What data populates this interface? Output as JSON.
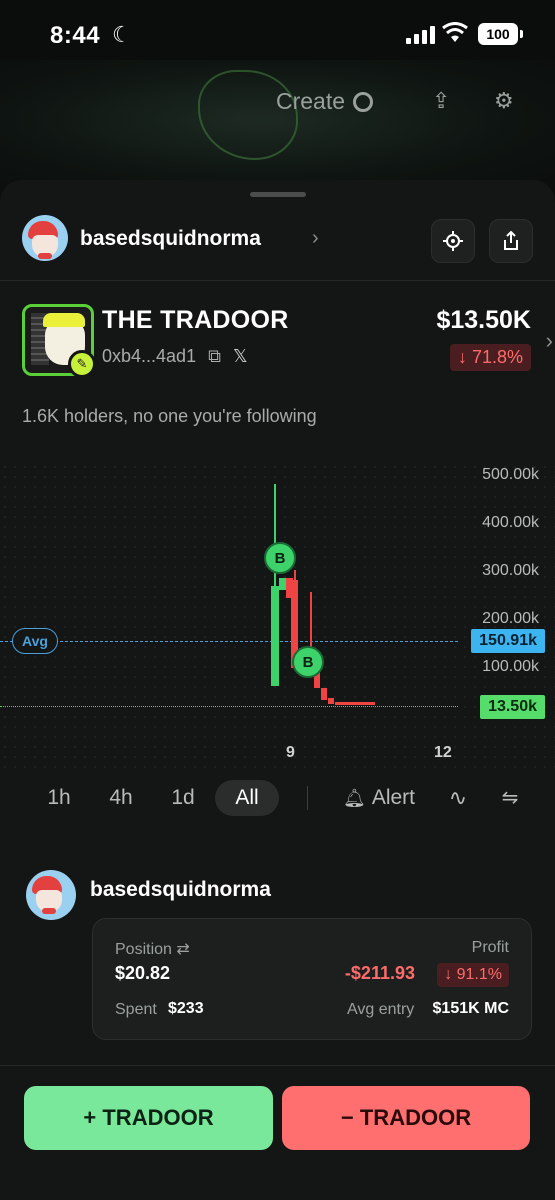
{
  "status_bar": {
    "time": "8:44",
    "battery": "100"
  },
  "background": {
    "create_label": "Create"
  },
  "header": {
    "username": "basedsquidnorma"
  },
  "token": {
    "name": "THE TRADOOR",
    "address": "0xb4...4ad1",
    "price": "$13.50K",
    "change": "↓ 71.8%"
  },
  "holders_text": "1.6K holders, no one you're following",
  "chart_data": {
    "type": "candlestick",
    "yticks": [
      "500.00k",
      "400.00k",
      "300.00k",
      "200.00k",
      "100.00k"
    ],
    "xticks": [
      "9",
      "12"
    ],
    "avg_label": "Avg",
    "avg_value": "150.91k",
    "current_value": "13.50k",
    "markers": [
      "B",
      "B"
    ]
  },
  "timeframes": {
    "items": [
      "1h",
      "4h",
      "1d",
      "All"
    ],
    "active": "All",
    "alert_label": "Alert"
  },
  "position": {
    "username": "basedsquidnorma",
    "position_label": "Position",
    "position_value": "$20.82",
    "profit_label": "Profit",
    "profit_value": "-$211.93",
    "profit_pct": "↓ 91.1%",
    "spent_label": "Spent",
    "spent_value": "$233",
    "avg_entry_label": "Avg entry",
    "avg_entry_value": "$151K MC"
  },
  "actions": {
    "buy_label": "+ TRADOOR",
    "sell_label": "− TRADOOR"
  },
  "colors": {
    "buy": "#7ae89a",
    "sell": "#ff6f6f",
    "accent_blue": "#3bb4ef",
    "loss": "#ff6b6b"
  }
}
